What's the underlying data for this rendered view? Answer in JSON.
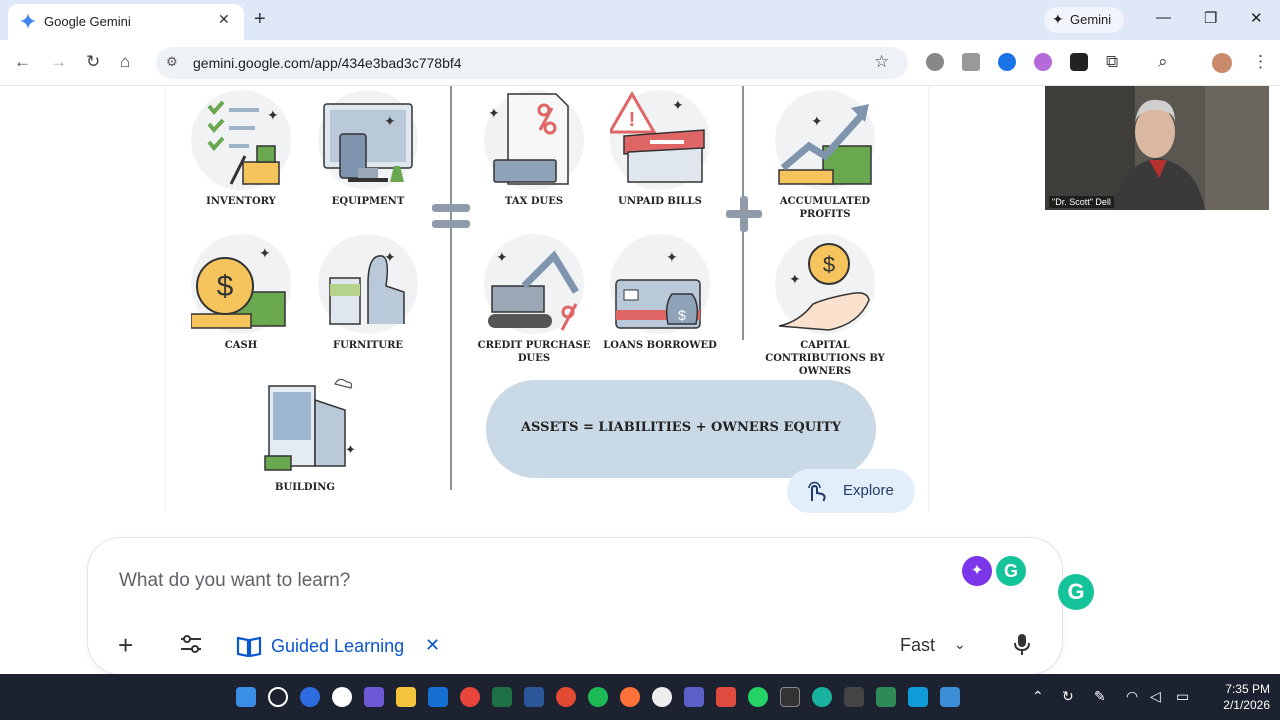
{
  "browser": {
    "tab_title": "Google Gemini",
    "gemini_button": "Gemini",
    "url": "gemini.google.com/app/434e3bad3c778bf4"
  },
  "infographic": {
    "assets": [
      "INVENTORY",
      "EQUIPMENT",
      "CASH",
      "FURNITURE",
      "BUILDING"
    ],
    "liabilities": [
      "TAX DUES",
      "UNPAID BILLS",
      "CREDIT PURCHASE DUES",
      "LOANS BORROWED"
    ],
    "equity": [
      "ACCUMULATED PROFITS",
      "CAPITAL CONTRIBUTIONS BY OWNERS"
    ],
    "equation": "ASSETS = LIABILITIES + OWNERS EQUITY",
    "explore_label": "Explore"
  },
  "webcam": {
    "name": "\"Dr. Scott\" Dell"
  },
  "prompt": {
    "placeholder": "What do you want to learn?",
    "guided_label": "Guided Learning",
    "mode": "Fast"
  },
  "clock": {
    "time": "7:35 PM",
    "date": "2/1/2026"
  },
  "colors": {
    "accent": "#0b57d0",
    "equation_bg": "#cad9e6",
    "taskbar": "#1c2230"
  }
}
